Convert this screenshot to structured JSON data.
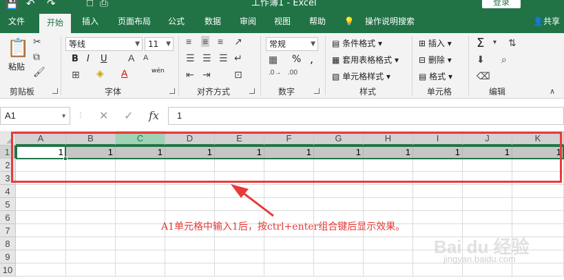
{
  "titlebar": {
    "title": "工作簿1 - Excel",
    "login_label": "登录",
    "qa_icons": [
      "save-icon",
      "undo-icon",
      "redo-icon",
      "new-icon",
      "print-preview-icon"
    ]
  },
  "tabs": [
    "文件",
    "开始",
    "插入",
    "页面布局",
    "公式",
    "数据",
    "审阅",
    "视图",
    "帮助"
  ],
  "active_tab": "开始",
  "search_label": "操作说明搜索",
  "share_label": "共享",
  "ribbon": {
    "clipboard": {
      "paste_label": "粘贴",
      "group_label": "剪贴板"
    },
    "font": {
      "font_name": "等线",
      "font_size": "11",
      "bold": "B",
      "italic": "I",
      "underline": "U",
      "phonetic": "wén",
      "group_label": "字体"
    },
    "alignment": {
      "group_label": "对齐方式"
    },
    "number": {
      "format": "常规",
      "percent": "%",
      "comma": ",",
      "group_label": "数字"
    },
    "styles": {
      "conditional": "条件格式",
      "table": "套用表格格式",
      "cell": "单元格样式",
      "group_label": "样式"
    },
    "cells": {
      "insert": "插入",
      "delete": "删除",
      "format": "格式",
      "group_label": "单元格"
    },
    "editing": {
      "sum": "Σ",
      "group_label": "编辑"
    }
  },
  "formula_bar": {
    "name_box": "A1",
    "cancel": "✕",
    "enter": "✓",
    "fx": "fx",
    "content": "1"
  },
  "grid": {
    "columns": [
      "A",
      "B",
      "C",
      "D",
      "E",
      "F",
      "G",
      "H",
      "I",
      "J",
      "K"
    ],
    "rows": [
      "1",
      "2",
      "3",
      "4",
      "5",
      "6",
      "7",
      "8",
      "9",
      "10"
    ],
    "row1_values": [
      "1",
      "1",
      "1",
      "1",
      "1",
      "1",
      "1",
      "1",
      "1",
      "1",
      "1"
    ]
  },
  "annotation": {
    "text": "A1单元格中输入1后，按ctrl+enter组合键后显示效果。",
    "color": "#e53935"
  },
  "watermark": {
    "logo": "Bai du 经验",
    "url": "jingyan.baidu.com"
  },
  "colors": {
    "excel_green": "#217346",
    "annotation_red": "#e83a3a"
  }
}
